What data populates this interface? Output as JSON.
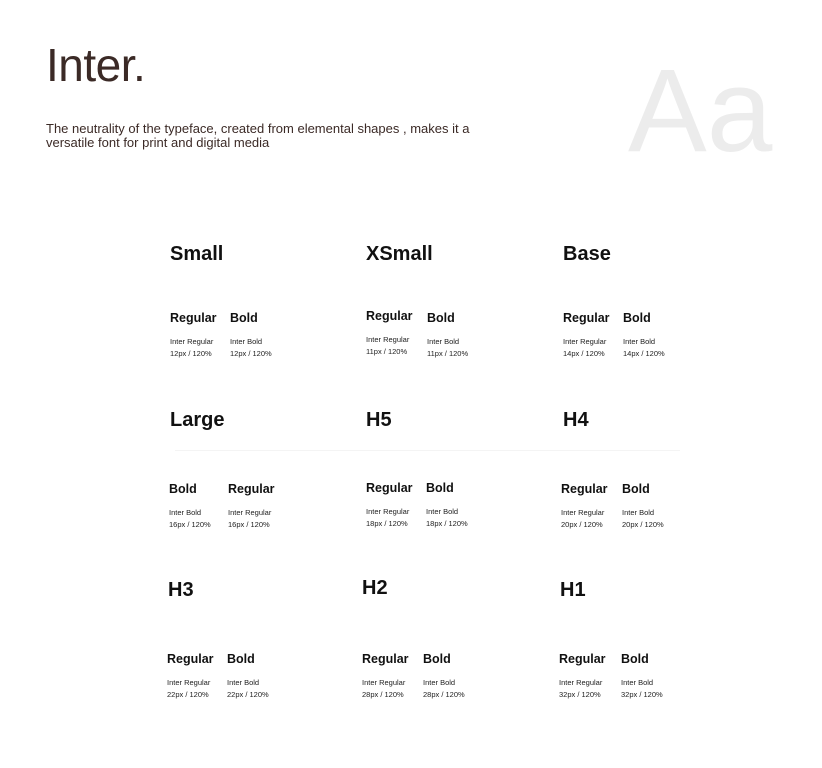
{
  "header": {
    "title": "Inter.",
    "description": "The neutrality of the typeface, created from elemental shapes , makes it a versatile font for print and digital media",
    "specimen": "Aa"
  },
  "scales": [
    {
      "name": "Small",
      "variants": [
        {
          "label": "Regular",
          "font": "Inter Regular",
          "spec": "12px / 120%"
        },
        {
          "label": "Bold",
          "font": "Inter Bold",
          "spec": "12px / 120%"
        }
      ]
    },
    {
      "name": "XSmall",
      "variants": [
        {
          "label": "Regular",
          "font": "Inter Regular",
          "spec": "11px / 120%"
        },
        {
          "label": "Bold",
          "font": "Inter Bold",
          "spec": "11px / 120%"
        }
      ]
    },
    {
      "name": "Base",
      "variants": [
        {
          "label": "Regular",
          "font": "Inter Regular",
          "spec": "14px / 120%"
        },
        {
          "label": "Bold",
          "font": "Inter Bold",
          "spec": "14px / 120%"
        }
      ]
    },
    {
      "name": "Large",
      "variants": [
        {
          "label": "Bold",
          "font": "Inter Bold",
          "spec": "16px / 120%"
        },
        {
          "label": "Regular",
          "font": "Inter Regular",
          "spec": "16px / 120%"
        }
      ]
    },
    {
      "name": "H5",
      "variants": [
        {
          "label": "Regular",
          "font": "Inter Regular",
          "spec": "18px / 120%"
        },
        {
          "label": "Bold",
          "font": "Inter Bold",
          "spec": "18px / 120%"
        }
      ]
    },
    {
      "name": "H4",
      "variants": [
        {
          "label": "Regular",
          "font": "Inter Regular",
          "spec": "20px / 120%"
        },
        {
          "label": "Bold",
          "font": "Inter Bold",
          "spec": "20px / 120%"
        }
      ]
    },
    {
      "name": "H3",
      "variants": [
        {
          "label": "Regular",
          "font": "Inter Regular",
          "spec": "22px / 120%"
        },
        {
          "label": "Bold",
          "font": "Inter Bold",
          "spec": "22px / 120%"
        }
      ]
    },
    {
      "name": "H2",
      "variants": [
        {
          "label": "Regular",
          "font": "Inter Regular",
          "spec": "28px / 120%"
        },
        {
          "label": "Bold",
          "font": "Inter Bold",
          "spec": "28px / 120%"
        }
      ]
    },
    {
      "name": "H1",
      "variants": [
        {
          "label": "Regular",
          "font": "Inter Regular",
          "spec": "32px / 120%"
        },
        {
          "label": "Bold",
          "font": "Inter Bold",
          "spec": "32px / 120%"
        }
      ]
    }
  ]
}
